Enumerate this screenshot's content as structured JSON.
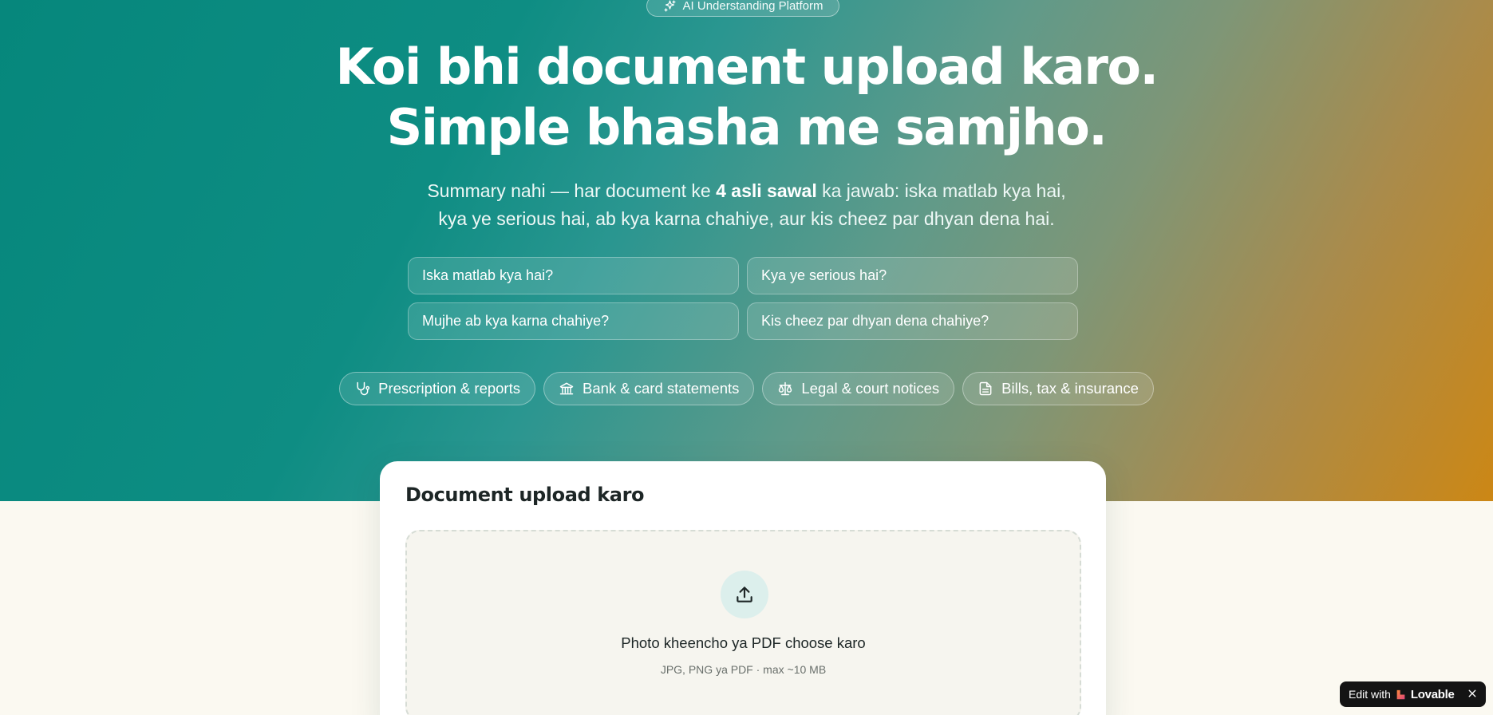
{
  "hero": {
    "badge_label": "AI Understanding Platform",
    "headline_line1": "Koi bhi document upload karo.",
    "headline_line2": "Simple bhasha me samjho.",
    "subtitle": {
      "part1": "Summary nahi — har document ke ",
      "bold": "4 asli sawal",
      "part2": " ka jawab: iska matlab kya hai,",
      "line2": "kya ye serious hai, ab kya karna chahiye, aur kis cheez par dhyan dena hai."
    },
    "questions": [
      "Iska matlab kya hai?",
      "Kya ye serious hai?",
      "Mujhe ab kya karna chahiye?",
      "Kis cheez par dhyan dena chahiye?"
    ],
    "categories": [
      {
        "label": "Prescription & reports",
        "icon": "stethoscope-icon"
      },
      {
        "label": "Bank & card statements",
        "icon": "bank-icon"
      },
      {
        "label": "Legal & court notices",
        "icon": "scale-icon"
      },
      {
        "label": "Bills, tax & insurance",
        "icon": "document-icon"
      }
    ]
  },
  "upload": {
    "title": "Document upload karo",
    "dropzone_title": "Photo kheencho ya PDF choose karo",
    "dropzone_hint": "JPG, PNG ya PDF · max ~10 MB",
    "icon": "upload-icon"
  },
  "lovable_badge": {
    "prefix": "Edit with",
    "brand": "Lovable"
  },
  "colors": {
    "gradient_start": "#06877c",
    "gradient_end": "#cc8715",
    "page_background": "#fbf9f1",
    "card_background": "#ffffff"
  }
}
